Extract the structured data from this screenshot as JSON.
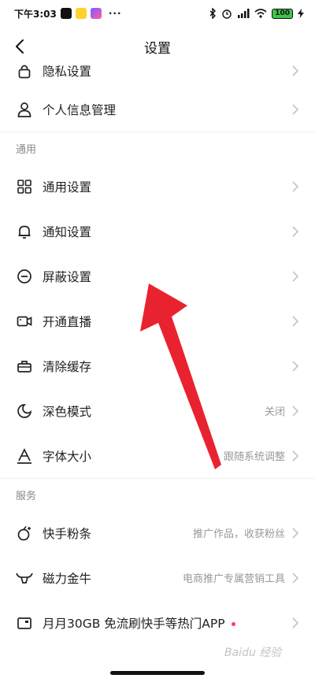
{
  "status_bar": {
    "time": "下午3:03",
    "more": "···",
    "battery": "100"
  },
  "nav": {
    "title": "设置"
  },
  "rows_top": [
    {
      "label": "隐私设置",
      "icon": "lock-icon"
    },
    {
      "label": "个人信息管理",
      "icon": "person-icon"
    }
  ],
  "section_general": {
    "title": "通用"
  },
  "rows_general": [
    {
      "label": "通用设置",
      "icon": "grid-icon"
    },
    {
      "label": "通知设置",
      "icon": "bell-icon"
    },
    {
      "label": "屏蔽设置",
      "icon": "block-icon"
    },
    {
      "label": "开通直播",
      "icon": "video-camera-icon"
    },
    {
      "label": "清除缓存",
      "icon": "toolbox-icon"
    },
    {
      "label": "深色模式",
      "icon": "moon-icon",
      "value": "关闭"
    },
    {
      "label": "字体大小",
      "icon": "font-size-icon",
      "value": "跟随系统调整"
    }
  ],
  "section_service": {
    "title": "服务"
  },
  "rows_service": [
    {
      "label": "快手粉条",
      "icon": "fans-icon",
      "value": "推广作品，收获粉丝"
    },
    {
      "label": "磁力金牛",
      "icon": "bull-icon",
      "value": "电商推广专属营销工具"
    },
    {
      "label": "月月30GB 免流刷快手等热门APP",
      "icon": "sim-card-icon"
    }
  ],
  "watermark": "Baidu 经验",
  "colors": {
    "arrow": "#e8232f",
    "accent_dot": "#ff3b5c"
  }
}
